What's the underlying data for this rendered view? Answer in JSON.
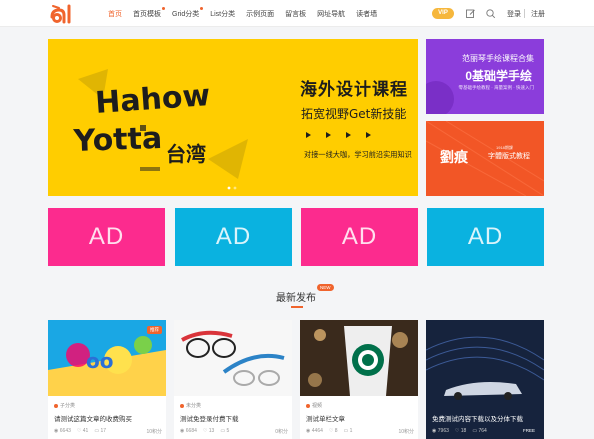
{
  "header": {
    "nav": [
      {
        "label": "首页",
        "active": true,
        "dot": false
      },
      {
        "label": "首页模板",
        "active": false,
        "dot": true
      },
      {
        "label": "Grid分类",
        "active": false,
        "dot": true
      },
      {
        "label": "List分类",
        "active": false,
        "dot": false
      },
      {
        "label": "示例页面",
        "active": false,
        "dot": false
      },
      {
        "label": "留言板",
        "active": false,
        "dot": false
      },
      {
        "label": "网址导航",
        "active": false,
        "dot": false
      },
      {
        "label": "读者墙",
        "active": false,
        "dot": false
      }
    ],
    "vip": "VIP",
    "login": "登录",
    "register": "注册"
  },
  "hero": {
    "title": "海外设计课程",
    "subtitle": "拓宽视野Get新技能",
    "desc": "对接一线大咖，学习前沿实用知识",
    "art_line1": "Hahow",
    "art_line2": "Yotta",
    "art_line3": "台湾"
  },
  "side_banners": [
    {
      "line1": "范丽琴手绘课程合集",
      "line2": "0基础学手绘",
      "line3": "零基础手绘教程 · 海量案例 · 快速入门"
    },
    {
      "big": "劉痕",
      "small": "字體版式教程",
      "tiny": "1918期課"
    }
  ],
  "ads": [
    {
      "label": "AD",
      "color": "#fc2b8e"
    },
    {
      "label": "AD",
      "color": "#0ab2e0"
    },
    {
      "label": "AD",
      "color": "#fc2b8e"
    },
    {
      "label": "AD",
      "color": "#0ab2e0"
    }
  ],
  "section": {
    "title": "最新发布",
    "badge": "NEW"
  },
  "cards": [
    {
      "category": "子分类",
      "title": "请测试这篇文章的收费购买",
      "views": "6643",
      "likes": "41",
      "comments": "17",
      "price": "10积分",
      "corner": "推荐",
      "corner_color": "#f0642d"
    },
    {
      "category": "未分类",
      "title": "测试免登录付费下载",
      "views": "6684",
      "likes": "13",
      "comments": "5",
      "price": "0积分",
      "corner": "",
      "corner_color": ""
    },
    {
      "category": "视频",
      "title": "测试单栏文章",
      "views": "4464",
      "likes": "8",
      "comments": "1",
      "price": "10积分",
      "corner": "",
      "corner_color": ""
    },
    {
      "category": "",
      "title": "免费测试内容下载以及分体下载",
      "views": "7963",
      "likes": "18",
      "comments": "764",
      "price": "",
      "corner": "FREE",
      "corner_color": "transparent"
    }
  ]
}
